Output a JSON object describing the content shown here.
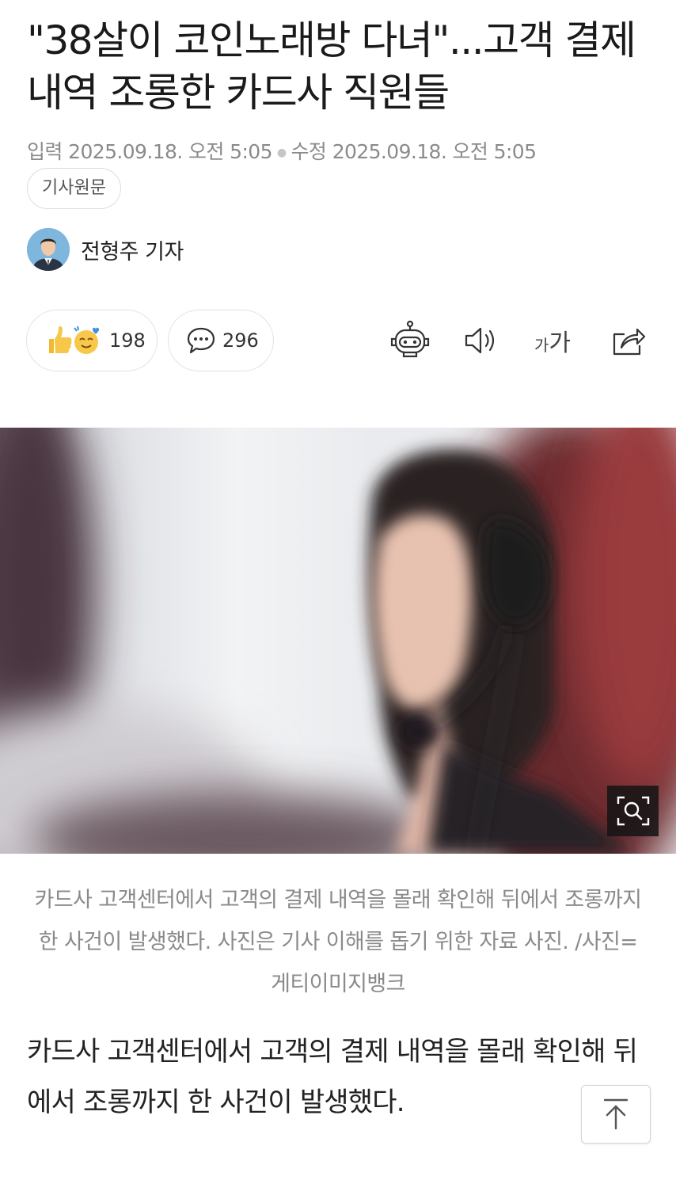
{
  "article": {
    "title": "\"38살이 코인노래방 다녀\"...고객 결제내역 조롱한 카드사 직원들",
    "published_label": "입력",
    "published": "2025.09.18. 오전 5:05",
    "modified_label": "수정",
    "modified": "2025.09.18. 오전 5:05",
    "source_button": "기사원문",
    "author": "전형주 기자",
    "reactions_count": "198",
    "comments_count": "296",
    "font_toggle": {
      "small": "가",
      "big": "가"
    },
    "photo_caption": "카드사 고객센터에서 고객의 결제 내역을 몰래 확인해 뒤에서 조롱까지 한 사건이 발생했다. 사진은 기사 이해를 돕기 위한 자료 사진. /사진=게티이미지뱅크",
    "body": "카드사 고객센터에서 고객의 결제 내역을 몰래 확인해 뒤에서 조롱까지 한 사건이 발생했다."
  },
  "icons": {
    "reaction": "thumbs-up-and-love-emoji",
    "comment": "speech-bubble-icon",
    "bot": "ai-summary-robot-icon",
    "speaker": "text-to-speech-icon",
    "share": "share-icon",
    "zoom": "zoom-image-icon",
    "scroll_top": "arrow-up-icon"
  }
}
